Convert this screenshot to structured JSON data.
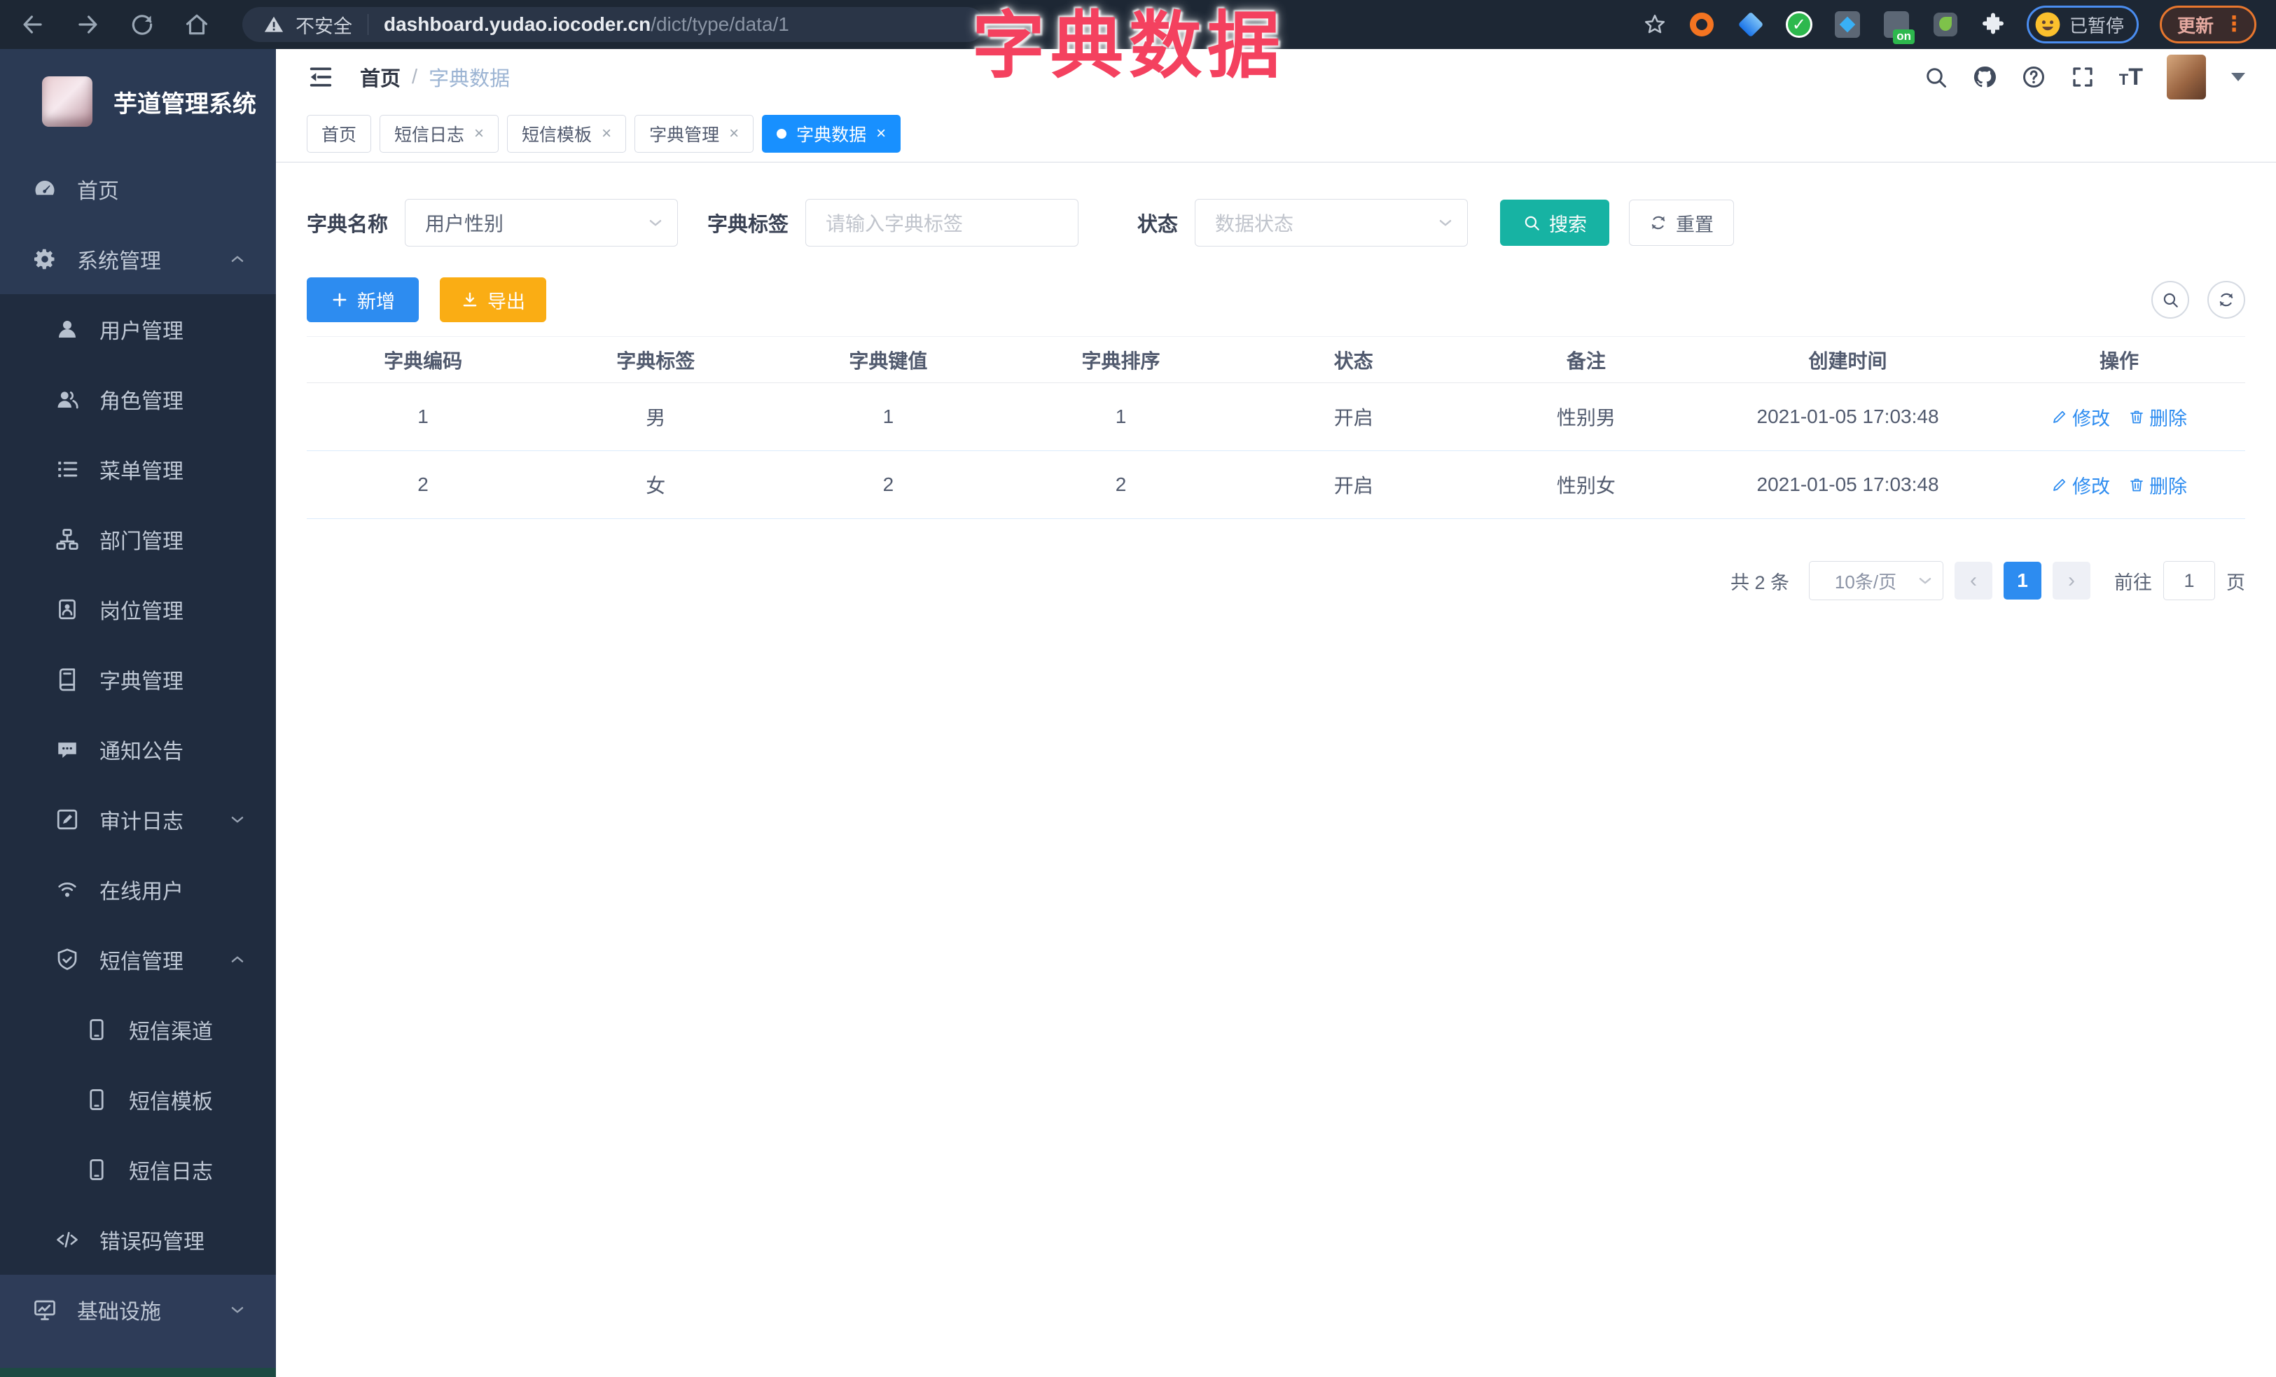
{
  "browser": {
    "security_warning": "不安全",
    "url_host": "dashboard.yudao.iocoder.cn",
    "url_path": "/dict/type/data/1",
    "extension_badge": "on",
    "profile_status": "已暂停",
    "update_button": "更新",
    "menu_dots": "⋮"
  },
  "overlay_title": "字典数据",
  "sidebar": {
    "app_title": "芋道管理系统",
    "items": [
      {
        "name": "home",
        "label": "首页",
        "icon": "gauge",
        "level": 0,
        "section": "top"
      },
      {
        "name": "system-management",
        "label": "系统管理",
        "icon": "gear",
        "level": 0,
        "section": "top",
        "chevron": "up"
      },
      {
        "name": "user-management",
        "label": "用户管理",
        "icon": "user",
        "level": 1,
        "section": "sub"
      },
      {
        "name": "role-management",
        "label": "角色管理",
        "icon": "users",
        "level": 1,
        "section": "sub"
      },
      {
        "name": "menu-management",
        "label": "菜单管理",
        "icon": "list",
        "level": 1,
        "section": "sub"
      },
      {
        "name": "dept-management",
        "label": "部门管理",
        "icon": "tree",
        "level": 1,
        "section": "sub"
      },
      {
        "name": "post-management",
        "label": "岗位管理",
        "icon": "badge",
        "level": 1,
        "section": "sub"
      },
      {
        "name": "dict-management",
        "label": "字典管理",
        "icon": "book",
        "level": 1,
        "section": "sub"
      },
      {
        "name": "notice-announcement",
        "label": "通知公告",
        "icon": "chat",
        "level": 1,
        "section": "sub"
      },
      {
        "name": "audit-log",
        "label": "审计日志",
        "icon": "editlog",
        "level": 1,
        "section": "sub",
        "chevron": "down"
      },
      {
        "name": "online-users",
        "label": "在线用户",
        "icon": "online",
        "level": 1,
        "section": "sub"
      },
      {
        "name": "sms-management",
        "label": "短信管理",
        "icon": "shield",
        "level": 1,
        "section": "sub",
        "chevron": "up"
      },
      {
        "name": "sms-channel",
        "label": "短信渠道",
        "icon": "phone",
        "level": 2,
        "section": "sub"
      },
      {
        "name": "sms-template",
        "label": "短信模板",
        "icon": "phone",
        "level": 2,
        "section": "sub"
      },
      {
        "name": "sms-log",
        "label": "短信日志",
        "icon": "phone",
        "level": 2,
        "section": "sub"
      },
      {
        "name": "error-code-management",
        "label": "错误码管理",
        "icon": "code",
        "level": 1,
        "section": "sub"
      },
      {
        "name": "infrastructure",
        "label": "基础设施",
        "icon": "monitor",
        "level": 0,
        "section": "bottom",
        "chevron": "down"
      }
    ]
  },
  "header": {
    "breadcrumb_home": "首页",
    "breadcrumb_sep": "/",
    "breadcrumb_current": "字典数据"
  },
  "tabs": [
    {
      "label": "首页",
      "closable": false,
      "active": false
    },
    {
      "label": "短信日志",
      "closable": true,
      "active": false
    },
    {
      "label": "短信模板",
      "closable": true,
      "active": false
    },
    {
      "label": "字典管理",
      "closable": true,
      "active": false
    },
    {
      "label": "字典数据",
      "closable": true,
      "active": true
    }
  ],
  "filters": {
    "dict_name_label": "字典名称",
    "dict_name_value": "用户性别",
    "dict_label_label": "字典标签",
    "dict_label_placeholder": "请输入字典标签",
    "status_label": "状态",
    "status_placeholder": "数据状态",
    "search_label": "搜索",
    "reset_label": "重置"
  },
  "toolbar": {
    "add_label": "新增",
    "export_label": "导出"
  },
  "table": {
    "columns": [
      "字典编码",
      "字典标签",
      "字典键值",
      "字典排序",
      "状态",
      "备注",
      "创建时间",
      "操作"
    ],
    "rows": [
      {
        "code": "1",
        "label": "男",
        "value": "1",
        "sort": "1",
        "status": "开启",
        "remark": "性别男",
        "created": "2021-01-05 17:03:48"
      },
      {
        "code": "2",
        "label": "女",
        "value": "2",
        "sort": "2",
        "status": "开启",
        "remark": "性别女",
        "created": "2021-01-05 17:03:48"
      }
    ],
    "edit_label": "修改",
    "delete_label": "删除"
  },
  "pagination": {
    "total_text": "共 2 条",
    "page_size": "10条/页",
    "prev": "‹",
    "next": "›",
    "current_page": "1",
    "goto_label": "前往",
    "goto_value": "1",
    "page_unit": "页"
  },
  "colors": {
    "primary": "#2d8cf0",
    "active_tab": "#1890ff",
    "search_teal": "#17b3a3",
    "export_amber": "#faad14",
    "overlay_pink": "#f4415f",
    "sidebar_dark": "#202c3f",
    "sidebar_light": "#2b3a54"
  }
}
